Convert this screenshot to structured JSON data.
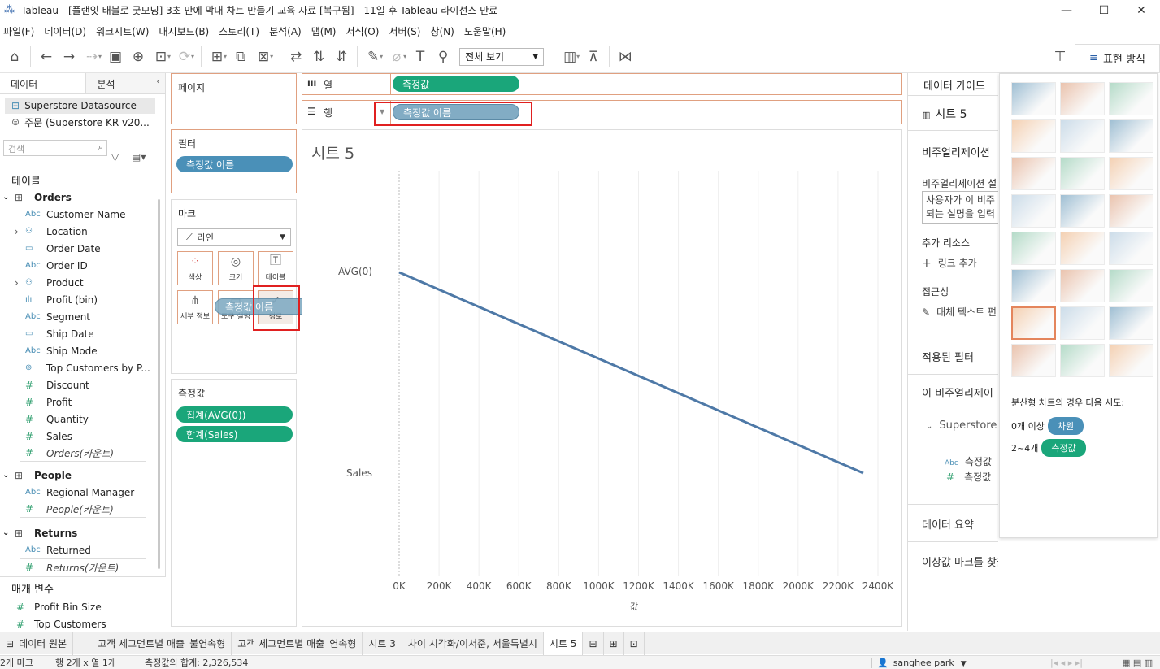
{
  "window": {
    "title": "Tableau - [플랜잇 태블로 굿모닝] 3초 만에 막대 차트 만들기 교육 자료 [복구됨] - 11일 후 Tableau 라이선스 만료",
    "minimize": "—",
    "maximize": "☐",
    "close": "✕"
  },
  "menu": [
    "파일(F)",
    "데이터(D)",
    "워크시트(W)",
    "대시보드(B)",
    "스토리(T)",
    "분석(A)",
    "맵(M)",
    "서식(O)",
    "서버(S)",
    "창(N)",
    "도움말(H)"
  ],
  "toolbar": {
    "fit": "전체 보기",
    "show_me": "표현 방식"
  },
  "data_pane": {
    "tabs": [
      "데이터",
      "분석"
    ],
    "datasources": [
      "Superstore Datasource",
      "주문 (Superstore KR v20..."
    ],
    "search_placeholder": "검색",
    "tables_label": "테이블",
    "orders": {
      "name": "Orders",
      "fields": [
        {
          "icon": "Abc",
          "name": "Customer Name"
        },
        {
          "icon": "geo",
          "name": "Location",
          "expand": true
        },
        {
          "icon": "cal",
          "name": "Order Date"
        },
        {
          "icon": "Abc",
          "name": "Order ID"
        },
        {
          "icon": "hier",
          "name": "Product",
          "expand": true
        },
        {
          "icon": "bin",
          "name": "Profit (bin)"
        },
        {
          "icon": "Abc",
          "name": "Segment"
        },
        {
          "icon": "cal",
          "name": "Ship Date"
        },
        {
          "icon": "Abc",
          "name": "Ship Mode"
        },
        {
          "icon": "set",
          "name": "Top Customers by P..."
        }
      ],
      "measures": [
        "Discount",
        "Profit",
        "Quantity",
        "Sales"
      ],
      "count": "Orders(카운트)"
    },
    "people": {
      "name": "People",
      "field": "Regional Manager",
      "count": "People(카운트)"
    },
    "returns": {
      "name": "Returns",
      "field": "Returned",
      "count": "Returns(카운트)"
    },
    "params_label": "매개 변수",
    "params": [
      "Profit Bin Size",
      "Top Customers"
    ]
  },
  "shelves": {
    "pages": "페이지",
    "filters": "필터",
    "filter_pill": "측정값 이름",
    "marks": "마크",
    "mark_type": "라인",
    "mark_buttons": [
      "색상",
      "크기",
      "테이블",
      "세부 정보",
      "도구 설명",
      "경로"
    ],
    "drag_pill": "측정값 이름",
    "measure_values": "측정값",
    "mv_pills": [
      "집계(AVG(0))",
      "합계(Sales)"
    ],
    "columns_label": "열",
    "columns_pill": "측정값",
    "rows_label": "행",
    "rows_pill": "측정값 이름"
  },
  "sheet": {
    "title": "시트 5",
    "y_labels": [
      "AVG(0)",
      "Sales"
    ],
    "x_title": "값"
  },
  "chart_data": {
    "type": "line",
    "x_ticks": [
      "0K",
      "200K",
      "400K",
      "600K",
      "800K",
      "1000K",
      "1200K",
      "1400K",
      "1600K",
      "1800K",
      "2000K",
      "2200K",
      "2400K"
    ],
    "xlim": [
      0,
      2400000
    ],
    "categories": [
      "AVG(0)",
      "Sales"
    ],
    "values": [
      0,
      2326534
    ],
    "xlabel": "값",
    "color": "#4e79a7"
  },
  "guide": {
    "title": "데이터 가이드",
    "sheet": "시트 5",
    "viz_desc": "비주얼리제이션",
    "desc_label": "비주얼리제이션 설",
    "desc_placeholder1": "사용자가 이 비주",
    "desc_placeholder2": "되는 설명을 입력",
    "resources": "추가 리소스",
    "add_link": "링크 추가",
    "accessibility": "접근성",
    "alt_text": "대체 텍스트 편",
    "applied_filters": "적용된 필터",
    "this_viz": "이 비주얼리제이",
    "ds": "Superstore",
    "f1": "측정값",
    "f2": "측정값",
    "data_summary": "데이터 요약",
    "no_outliers": "이상값 마크를 찾을 수 없음"
  },
  "showme": {
    "hint": "분산형 차트의 경우 다음 시도:",
    "dim_count": "0개 이상",
    "dim_pill": "차원",
    "meas_count": "2~4개",
    "meas_pill": "측정값"
  },
  "tabs": {
    "datasource": "데이터 원본",
    "sheets": [
      "고객 세그먼트별 매출_불연속형",
      "고객 세그먼트별 매출_연속형",
      "시트 3",
      "차이 시각화/이서준, 서울특별시",
      "시트 5"
    ]
  },
  "status": {
    "marks": "2개 마크",
    "rowscols": "행 2개  x  열 1개",
    "sum": "측정값의 합계: 2,326,534",
    "user": "sanghee park"
  }
}
